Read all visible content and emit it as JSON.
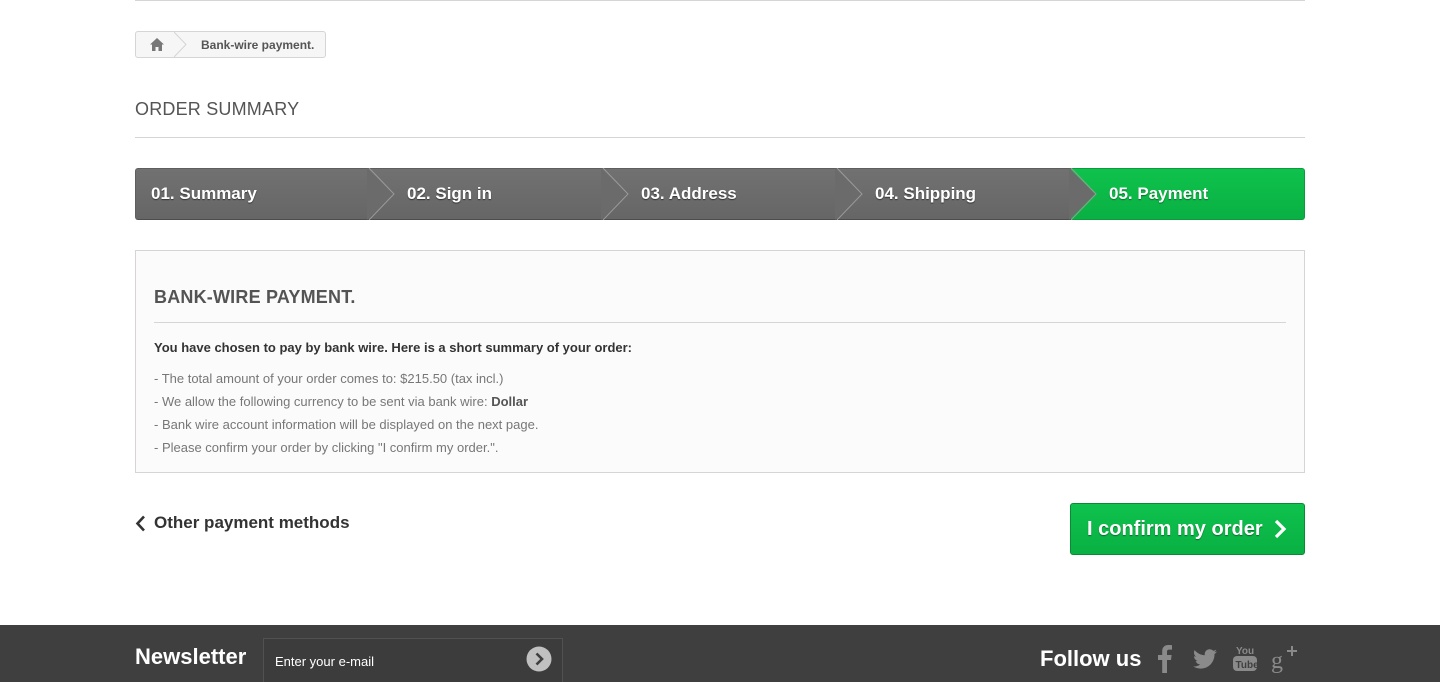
{
  "breadcrumb": {
    "home_icon": "home-icon",
    "current": "Bank-wire payment."
  },
  "page": {
    "title": "ORDER SUMMARY"
  },
  "steps": [
    {
      "label": "01. Summary",
      "active": false
    },
    {
      "label": "02. Sign in",
      "active": false
    },
    {
      "label": "03. Address",
      "active": false
    },
    {
      "label": "04. Shipping",
      "active": false
    },
    {
      "label": "05. Payment",
      "active": true
    }
  ],
  "payment": {
    "title": "BANK-WIRE PAYMENT.",
    "intro": "You have chosen to pay by bank wire. Here is a short summary of your order:",
    "line_total": "- The total amount of your order comes to: $215.50 (tax incl.)",
    "line_currency_prefix": "- We allow the following currency to be sent via bank wire: ",
    "line_currency_value": "Dollar",
    "line_account": "- Bank wire account information will be displayed on the next page.",
    "line_confirm": "- Please confirm your order by clicking \"I confirm my order.\"."
  },
  "actions": {
    "back_label": "Other payment methods",
    "confirm_label": "I confirm my order"
  },
  "footer": {
    "newsletter_title": "Newsletter",
    "newsletter_placeholder": "Enter your e-mail",
    "follow_title": "Follow us",
    "social_icons": [
      "facebook-icon",
      "twitter-icon",
      "youtube-icon",
      "google-plus-icon"
    ]
  },
  "colors": {
    "step_inactive": "#6b6b6b",
    "step_active": "#0db14b",
    "confirm_button": "#0db14b",
    "footer_bg": "#3f3f3f"
  }
}
